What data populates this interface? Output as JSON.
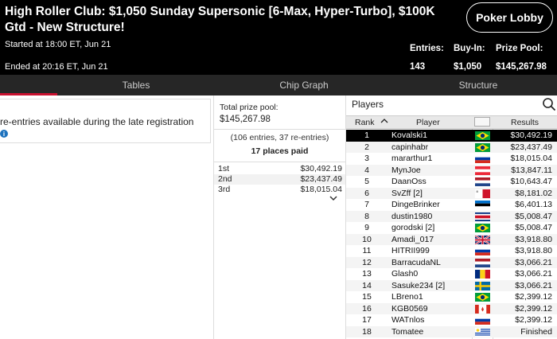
{
  "header": {
    "title": "High Roller Club: $1,050 Sunday Supersonic [6-Max, Hyper-Turbo], $100K Gtd - New Structure!",
    "started": "Started at 18:00 ET, Jun 21",
    "ended": "Ended at 20:16 ET, Jun 21",
    "lobby_button": "Poker Lobby",
    "entries_label": "Entries:",
    "entries_value": "143",
    "buyin_label": "Buy-In:",
    "buyin_value": "$1,050",
    "prize_label": "Prize Pool:",
    "prize_value": "$145,267.98"
  },
  "tabs": [
    "Tables",
    "Chip Graph",
    "Structure"
  ],
  "notice": {
    "text": "re-entries available during the late registration",
    "icon": "info-icon"
  },
  "prize_panel": {
    "label": "Total prize pool:",
    "value": "$145,267.98",
    "entries_note": "(106 entries, 37 re-entries)",
    "places_paid": "17 places paid",
    "payouts": [
      {
        "place": "1st",
        "amount": "$30,492.19"
      },
      {
        "place": "2nd",
        "amount": "$23,437.49"
      },
      {
        "place": "3rd",
        "amount": "$18,015.04"
      }
    ]
  },
  "players": {
    "title": "Players",
    "columns": {
      "rank": "Rank",
      "player": "Player",
      "results": "Results"
    },
    "rows": [
      {
        "rank": "1",
        "name": "Kovalski1",
        "flag": "brazil",
        "result": "$30,492.19",
        "selected": true
      },
      {
        "rank": "2",
        "name": "capinhabr",
        "flag": "brazil",
        "result": "$23,437.49"
      },
      {
        "rank": "3",
        "name": "mararthur1",
        "flag": "russia",
        "result": "$18,015.04"
      },
      {
        "rank": "4",
        "name": "MynJoe",
        "flag": "austria",
        "result": "$13,847.11"
      },
      {
        "rank": "5",
        "name": "DaanOss",
        "flag": "netherlands",
        "result": "$10,643.47"
      },
      {
        "rank": "6",
        "name": "SvZff [2]",
        "flag": "malta",
        "result": "$8,181.02"
      },
      {
        "rank": "7",
        "name": "DingeBrinker",
        "flag": "estonia",
        "result": "$6,401.13"
      },
      {
        "rank": "8",
        "name": "dustin1980",
        "flag": "costa-rica",
        "result": "$5,008.47"
      },
      {
        "rank": "9",
        "name": "gorodski [2]",
        "flag": "brazil",
        "result": "$5,008.47"
      },
      {
        "rank": "10",
        "name": "Amadi_017",
        "flag": "uk",
        "result": "$3,918.80"
      },
      {
        "rank": "11",
        "name": "HITRII999",
        "flag": "russia",
        "result": "$3,918.80"
      },
      {
        "rank": "12",
        "name": "BarracudaNL",
        "flag": "netherlands",
        "result": "$3,066.21"
      },
      {
        "rank": "13",
        "name": "Glash0",
        "flag": "romania",
        "result": "$3,066.21"
      },
      {
        "rank": "14",
        "name": "Sasuke234 [2]",
        "flag": "sweden",
        "result": "$3,066.21"
      },
      {
        "rank": "15",
        "name": "LBreno1",
        "flag": "brazil",
        "result": "$2,399.12"
      },
      {
        "rank": "16",
        "name": "KGB0569",
        "flag": "canada",
        "result": "$2,399.12"
      },
      {
        "rank": "17",
        "name": "WATnlos",
        "flag": "russia",
        "result": "$2,399.12"
      },
      {
        "rank": "18",
        "name": "Tomatee",
        "flag": "uruguay",
        "result": "Finished"
      }
    ]
  },
  "colors": {
    "accent": "#c8102e",
    "header_bg": "#000000",
    "tabbar_bg": "#262626"
  }
}
